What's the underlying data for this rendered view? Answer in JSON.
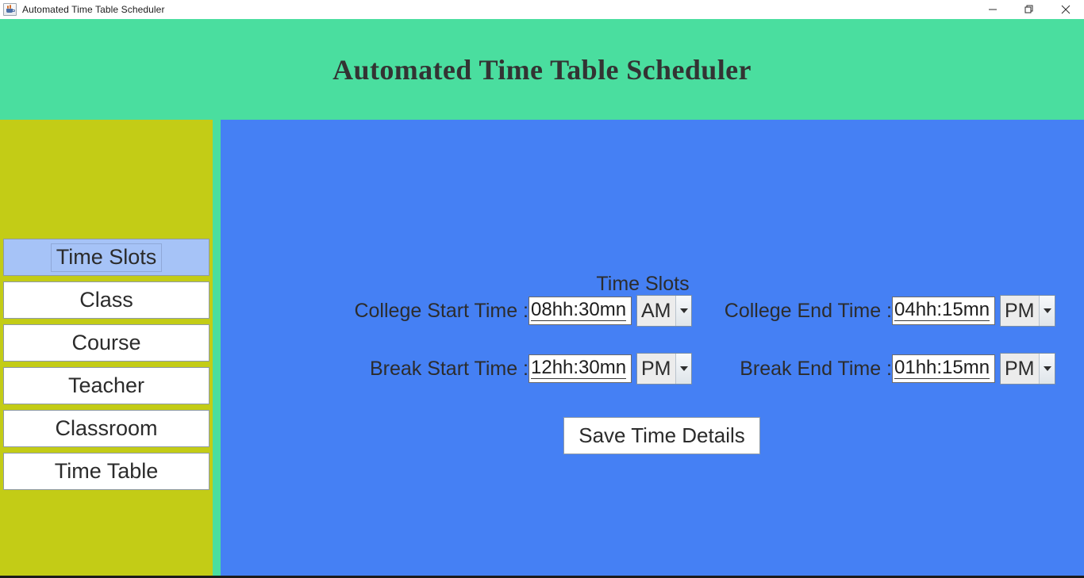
{
  "window": {
    "title": "Automated Time Table Scheduler",
    "icon": "java-coffee-cup-icon",
    "controls": {
      "minimize": "minimize-icon",
      "maximize": "restore-icon",
      "close": "close-icon"
    }
  },
  "header": {
    "title": "Automated Time Table Scheduler"
  },
  "sidebar": {
    "items": [
      {
        "label": "Time Slots",
        "selected": true
      },
      {
        "label": "Class",
        "selected": false
      },
      {
        "label": "Course",
        "selected": false
      },
      {
        "label": "Teacher",
        "selected": false
      },
      {
        "label": "Classroom",
        "selected": false
      },
      {
        "label": "Time Table",
        "selected": false
      }
    ]
  },
  "main": {
    "section_title": "Time Slots",
    "fields": {
      "college_start": {
        "label": "College Start Time :",
        "value": "08hh:30mn",
        "meridiem": "AM"
      },
      "college_end": {
        "label": "College End Time :",
        "value": "04hh:15mn",
        "meridiem": "PM"
      },
      "break_start": {
        "label": "Break Start Time :",
        "value": "12hh:30mn",
        "meridiem": "PM"
      },
      "break_end": {
        "label": "Break End Time :",
        "value": "01hh:15mn",
        "meridiem": "PM"
      }
    },
    "save_button": "Save Time Details"
  },
  "colors": {
    "header_green": "#4ade9f",
    "sidebar_yellow": "#c3cc16",
    "main_blue": "#4580f4",
    "selected_item": "#a6c3f7"
  }
}
